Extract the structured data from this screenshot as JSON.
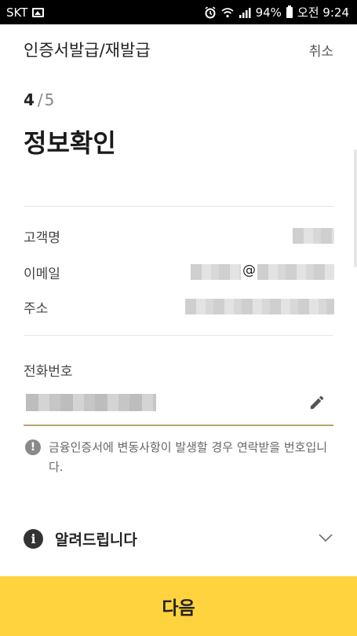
{
  "status_bar": {
    "carrier": "SKT",
    "battery": "94%",
    "time": "오전 9:24"
  },
  "header": {
    "title": "인증서발급/재발급",
    "cancel_label": "취소"
  },
  "step": {
    "current": "4",
    "separator": "/",
    "total": "5"
  },
  "section_title": "정보확인",
  "customer_info": {
    "name_label": "고객명",
    "email_label": "이메일",
    "email_at": "@",
    "address_label": "주소"
  },
  "phone": {
    "label": "전화번호"
  },
  "notice_text": "금융인증서에 변동사항이 발생할 경우 연락받을 번호입니다.",
  "info": {
    "icon_glyph": "i",
    "label": "알려드립니다"
  },
  "next_button_label": "다음",
  "colors": {
    "accent_yellow": "#ffd33d",
    "field_underline": "#b7a46f"
  }
}
